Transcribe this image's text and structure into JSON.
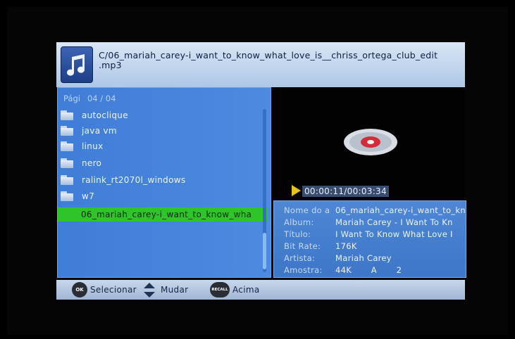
{
  "header": {
    "icon": "music-note-icon",
    "path_line1": "C/06_mariah_carey-i_want_to_know_what_love_is__chriss_ortega_club_edit",
    "path_line2": ".mp3"
  },
  "list": {
    "page_label": "Pági",
    "page_number": "04 / 04",
    "items": [
      {
        "label": "autoclique",
        "icon": "folder-icon"
      },
      {
        "label": "java vm",
        "icon": "folder-icon"
      },
      {
        "label": "linux",
        "icon": "folder-icon"
      },
      {
        "label": "nero",
        "icon": "folder-icon"
      },
      {
        "label": "ralink_rt2070l_windows",
        "icon": "folder-icon"
      },
      {
        "label": "w7",
        "icon": "folder-icon"
      }
    ],
    "selected_item": "06_mariah_carey-i_want_to_know_wha"
  },
  "player": {
    "time": "00:00:11/00:03:34",
    "play_icon": "play-icon",
    "disc_icon": "cd-icon"
  },
  "info": {
    "nome_key": "Nome do a",
    "nome_value": "06_mariah_carey-i_want_to_kn",
    "album_key": "Album:",
    "album_value": "Mariah Carey - I Want To Kn",
    "titulo_key": "Título:",
    "titulo_value": "I Want To Know What Love I",
    "bitrate_key": "Bit Rate:",
    "bitrate_value": "176K",
    "artista_key": "Artista:",
    "artista_value": "Mariah Carey",
    "amostra_key": "Amostra:",
    "amostra_value": "44K       A       2"
  },
  "footer": {
    "ok_badge": "OK",
    "select_label": "Selecionar",
    "change_label": "Mudar",
    "recall_badge": "RECALL",
    "up_label": "Acima"
  },
  "colors": {
    "list_bg": "#4585dc",
    "selected_bg": "#2fc42a",
    "info_bg": "#4a82d2",
    "play_icon": "#e6c21c"
  }
}
